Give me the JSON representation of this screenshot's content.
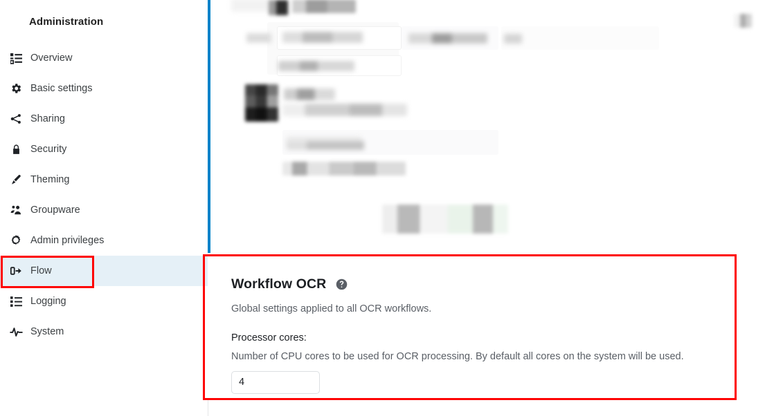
{
  "sidebar": {
    "title": "Administration",
    "items": [
      {
        "label": "Overview",
        "icon": "list-details-icon",
        "active": false
      },
      {
        "label": "Basic settings",
        "icon": "gear-icon",
        "active": false
      },
      {
        "label": "Sharing",
        "icon": "share-icon",
        "active": false
      },
      {
        "label": "Security",
        "icon": "lock-icon",
        "active": false
      },
      {
        "label": "Theming",
        "icon": "paintbrush-icon",
        "active": false
      },
      {
        "label": "Groupware",
        "icon": "people-icon",
        "active": false
      },
      {
        "label": "Admin privileges",
        "icon": "gear-person-icon",
        "active": false
      },
      {
        "label": "Flow",
        "icon": "flow-exit-icon",
        "active": true
      },
      {
        "label": "Logging",
        "icon": "list-icon",
        "active": false
      },
      {
        "label": "System",
        "icon": "activity-icon",
        "active": false
      }
    ]
  },
  "ocr_card": {
    "title": "Workflow OCR",
    "help_icon": "help-circle-icon",
    "subtitle": "Global settings applied to all OCR workflows.",
    "field_label": "Processor cores:",
    "field_description": "Number of CPU cores to be used for OCR processing. By default all cores on the system will be used.",
    "field_value": "4"
  },
  "annotations": {
    "color": "#fe0000",
    "boxes": [
      {
        "target": "sidebar-item-flow"
      },
      {
        "target": "workflow-ocr-card"
      }
    ]
  },
  "theme": {
    "accent": "#0082c9",
    "active_nav_background": "#e5f0f7",
    "text_primary": "#1c1f23",
    "text_secondary": "#5a5f66",
    "input_border": "#dcdfe2"
  }
}
